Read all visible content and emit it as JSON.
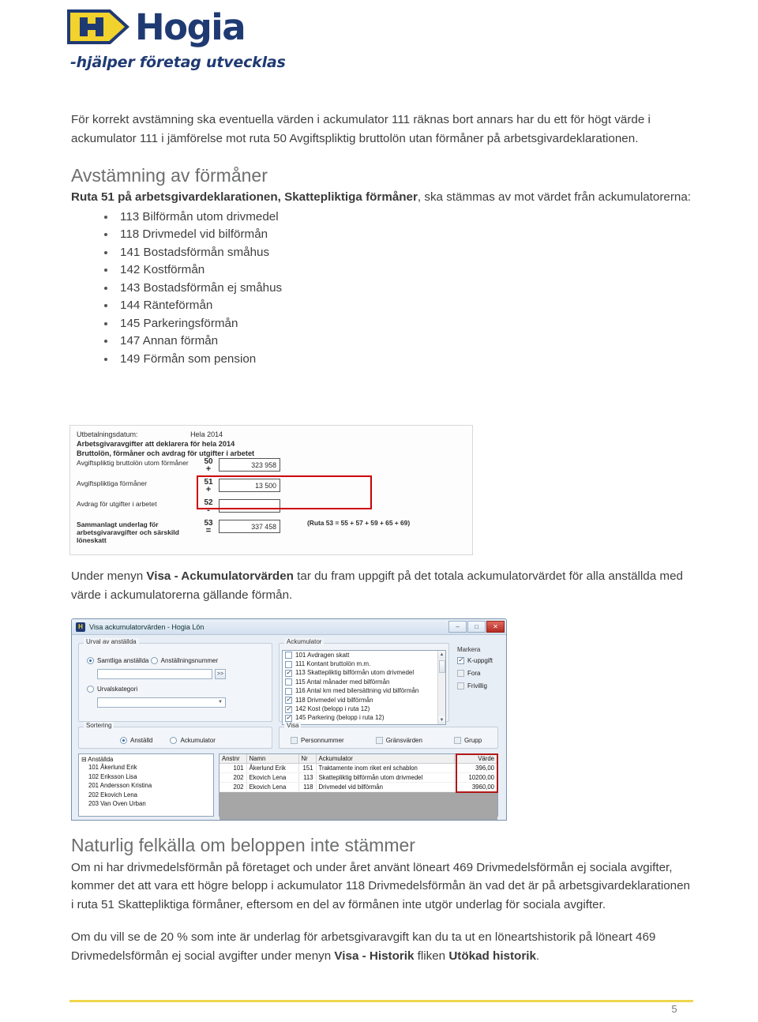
{
  "logo": {
    "badge_letter": "H",
    "wordmark": "Hogia",
    "tagline": "-hjälper företag utvecklas",
    "brand_blue": "#1f3a73",
    "brand_yellow": "#f2d22c"
  },
  "intro_paragraph": "För korrekt avstämning ska eventuella värden i ackumulator 111 räknas bort annars har du ett för högt värde i ackumulator 111 i jämförelse mot ruta 50 Avgiftspliktig bruttolön utan förmåner på arbetsgivardeklarationen.",
  "section_forman": {
    "heading": "Avstämning av förmåner",
    "lead_before": "Ruta 51 på arbetsgivardeklarationen, ",
    "lead_bold": "Skattepliktiga förmåner",
    "lead_after": ", ska stämmas av mot värdet från ackumulatorerna:",
    "bullets": [
      "113 Bilförmån utom drivmedel",
      "118 Drivmedel vid bilförmån",
      "141 Bostadsförmån småhus",
      "142 Kostförmån",
      "143 Bostadsförmån ej småhus",
      "144 Ränteförmån",
      "145 Parkeringsförmån",
      "147 Annan förmån",
      "149 Förmån som pension"
    ]
  },
  "figure_form": {
    "payout_label": "Utbetalningsdatum:",
    "payout_value": "Hela 2014",
    "header1": "Arbetsgivaravgifter att deklarera för hela 2014",
    "header2": "Bruttolön, förmåner och avdrag för utgifter i arbetet",
    "rows": [
      {
        "label": "Avgiftspliktig bruttolön utom förmåner",
        "no": "50",
        "op": "+",
        "value": "323 958",
        "bold": false
      },
      {
        "label": "Avgiftspliktiga förmåner",
        "no": "51",
        "op": "+",
        "value": "13 500",
        "bold": false
      },
      {
        "label": "Avdrag för utgifter i arbetet",
        "no": "52",
        "op": "-",
        "value": "",
        "bold": false
      },
      {
        "label": "Sammanlagt underlag för arbetsgivaravgifter och särskild löneskatt",
        "no": "53",
        "op": "=",
        "value": "337 458",
        "bold": true
      }
    ],
    "note": "(Ruta 53 = 55 + 57 + 59 + 65 + 69)",
    "highlight_color": "#cc0000"
  },
  "mid_paragraph": {
    "before": "Under menyn ",
    "bold": "Visa - Ackumulatorvärden",
    "after": " tar du fram uppgift på det totala ackumulatorvärdet för alla anställda med värde i ackumulatorerna gällande förmån."
  },
  "dialog": {
    "title": "Visa ackumulatorvärden - Hogia Lön",
    "icon": "hogia-app-icon",
    "window_buttons": [
      {
        "name": "minimize",
        "glyph": "–"
      },
      {
        "name": "maximize",
        "glyph": "□"
      },
      {
        "name": "close",
        "glyph": "✕"
      }
    ],
    "group_urval": {
      "legend": "Urval av anställda",
      "radio_samtliga": {
        "label": "Samtliga anställda",
        "checked": true
      },
      "radio_anstallningsnummer": {
        "label": "Anställningsnummer",
        "checked": false
      },
      "anstallningsnummer_value": "",
      "browse_button": ">>",
      "radio_urvalskategori": {
        "label": "Urvalskategori",
        "checked": false
      },
      "urvalskategori_value": ""
    },
    "group_sortering": {
      "legend": "Sortering",
      "radio_anstalld": {
        "label": "Anställd",
        "checked": true
      },
      "radio_ackumulator": {
        "label": "Ackumulator",
        "checked": false
      }
    },
    "group_ackumulator": {
      "legend": "Ackumulator",
      "items": [
        {
          "label": "101 Avdragen skatt",
          "checked": false
        },
        {
          "label": "111 Kontant bruttolön m.m.",
          "checked": false
        },
        {
          "label": "113 Skattepliktig bilförmån utom drivmedel",
          "checked": true
        },
        {
          "label": "115 Antal månader med bilförmån",
          "checked": false
        },
        {
          "label": "116 Antal km med bilersättning vid bilförmån",
          "checked": false
        },
        {
          "label": "118 Drivmedel vid bilförmån",
          "checked": true
        },
        {
          "label": "142 Kost (belopp i ruta 12)",
          "checked": true
        },
        {
          "label": "145 Parkering (belopp i ruta 12)",
          "checked": true
        }
      ]
    },
    "group_markera": {
      "legend": "Markera",
      "items": [
        {
          "label": "K-uppgift",
          "checked": true
        },
        {
          "label": "Fora",
          "checked": false
        },
        {
          "label": "Frivillig",
          "checked": false
        }
      ]
    },
    "group_visa": {
      "legend": "Visa",
      "items": [
        {
          "label": "Personnummer",
          "checked": false
        },
        {
          "label": "Gränsvärden",
          "checked": false
        },
        {
          "label": "Grupp",
          "checked": false
        }
      ]
    },
    "tree": {
      "root": "Anställda",
      "items": [
        "101 Åkerlund Erik",
        "102 Eriksson Lisa",
        "201 Andersson Kristina",
        "202 Ekovich Lena",
        "203 Van Oven Urban"
      ]
    },
    "grid": {
      "columns": [
        "Anstnr",
        "Namn",
        "Nr",
        "Ackumulator",
        "Värde"
      ],
      "rows": [
        [
          "101",
          "Åkerlund Erik",
          "151",
          "Traktamente inom riket enl schablon",
          "396,00"
        ],
        [
          "202",
          "Ekovich Lena",
          "113",
          "Skattepliktig bilförmån utom drivmedel",
          "10200,00"
        ],
        [
          "202",
          "Ekovich Lena",
          "118",
          "Drivmedel vid bilförmån",
          "3960,00"
        ]
      ],
      "highlight_color": "#b01818"
    }
  },
  "section_felkalla": {
    "heading": "Naturlig felkälla om beloppen inte stämmer",
    "paragraph1": "Om ni har drivmedelsförmån på företaget och under året använt löneart 469 Drivmedelsförmån ej sociala avgifter, kommer det att vara ett högre belopp i ackumulator 118 Drivmedelsförmån än vad det är på arbetsgivardeklarationen i ruta 51 Skattepliktiga förmåner, eftersom en del av förmånen inte utgör underlag för sociala avgifter.",
    "paragraph2_before": "Om du vill se de 20 % som inte är underlag för arbetsgivaravgift kan du ta ut en löneartshistorik på löneart 469 Drivmedelsförmån ej social avgifter under menyn ",
    "paragraph2_bold1": "Visa - Historik",
    "paragraph2_mid": " fliken ",
    "paragraph2_bold2": "Utökad historik",
    "paragraph2_end": "."
  },
  "footer": {
    "page_number": "5",
    "rule_color": "#f0d64e"
  }
}
